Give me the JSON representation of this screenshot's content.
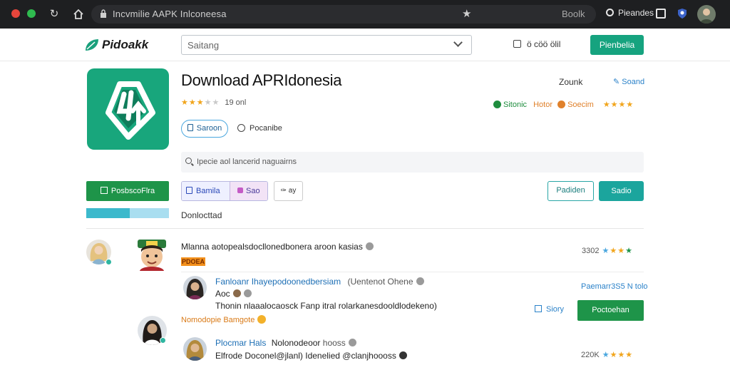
{
  "browser": {
    "url": "Incvmilie AAPK Inlconeesa",
    "zoom": "Boolk",
    "profile_name": "Pieandes"
  },
  "site": {
    "logo_text": "Pidoakk",
    "search_placeholder": "Saitang",
    "header_info": "ö cöö ölil",
    "header_cta": "Pienbelia"
  },
  "app": {
    "title": "Download APRIdonesia",
    "rating_count": "19 onl",
    "rating_stars": 3,
    "primary_pill": "Saroon",
    "favorite_link": "Pocanibe",
    "zoom_link": "Zounk",
    "send_link": "Soand",
    "badge_ok": "Sitonic",
    "badge_note": "Hotor",
    "badge_social": "Soecim",
    "badge_stars": 4
  },
  "subsearch": {
    "placeholder": "Ipecie aol lancerid naguairns"
  },
  "download": {
    "button_label": "PosbscoFlra",
    "progress": 0.53,
    "label": "Donlocttad"
  },
  "toolbar": {
    "tab_a": "Bamila",
    "tab_b": "Sao",
    "tool": "ay",
    "outline_btn": "Padiden",
    "teal_btn": "Sadio"
  },
  "comments": [
    {
      "text": "Mlanna aotopealsdocllonedbonera aroon kasias",
      "tag": "PDOEA",
      "score": "3302",
      "stars": 4
    },
    {
      "name": "Fanloanr Ihayepodoonedbersiam",
      "meta": "(Uentenot Ohene",
      "line2": "Aoc",
      "body": "Thonin nlaaalocaosck Fanp itral rolarkanesdooldlodekeno)",
      "right_link": "Paemarr3S5 N tolo",
      "reply_label": "Siory",
      "action_label": "Poctoehan",
      "note": "Nomodopie Bamgote"
    },
    {
      "name": "Plocmar Hals",
      "meta": "Nolonodeoor",
      "meta2": "hooss",
      "body": "Elfrode Doconel@jlanl) Idenelied @clanjhoooss",
      "score": "220K",
      "stars": 4
    }
  ]
}
